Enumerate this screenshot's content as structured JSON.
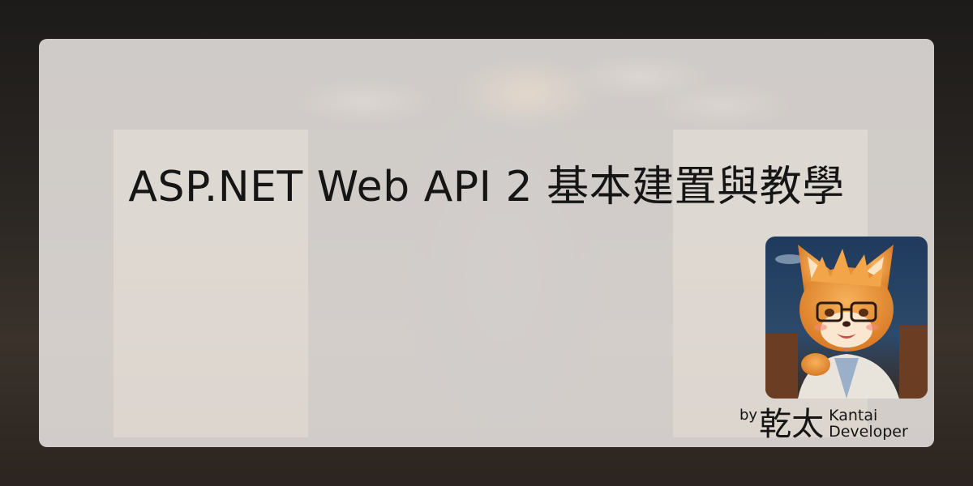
{
  "title": "ASP.NET Web API 2 基本建置與教學",
  "author": {
    "prefix": "by",
    "name_cn": "乾太",
    "name_en": "Kantai",
    "role": "Developer"
  },
  "avatar": {
    "icon": "fox-avatar-icon"
  },
  "colors": {
    "card": "#ECE8E4",
    "text": "#151515",
    "fur": "#E8953A"
  }
}
